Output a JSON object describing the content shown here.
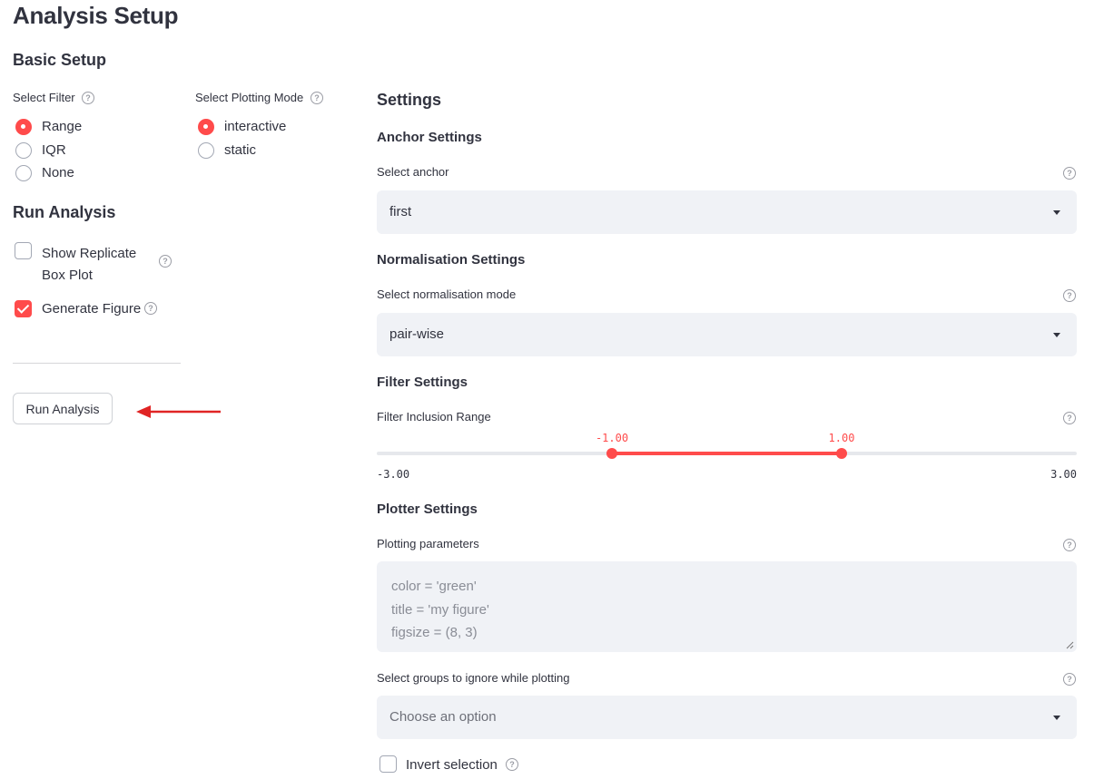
{
  "page_title": "Analysis Setup",
  "basic_setup": {
    "heading": "Basic Setup",
    "filter": {
      "label": "Select Filter",
      "options": [
        "Range",
        "IQR",
        "None"
      ],
      "selected": "Range"
    },
    "plotting_mode": {
      "label": "Select Plotting Mode",
      "options": [
        "interactive",
        "static"
      ],
      "selected": "interactive"
    }
  },
  "run_analysis": {
    "heading": "Run Analysis",
    "show_replicate_box_plot": {
      "label_line1": "Show Replicate",
      "label_line2": "Box Plot",
      "checked": false
    },
    "generate_figure": {
      "label": "Generate Figure",
      "checked": true
    },
    "button_label": "Run Analysis"
  },
  "settings": {
    "heading": "Settings",
    "anchor": {
      "heading": "Anchor Settings",
      "label": "Select anchor",
      "value": "first"
    },
    "normalisation": {
      "heading": "Normalisation Settings",
      "label": "Select normalisation mode",
      "value": "pair-wise"
    },
    "filter": {
      "heading": "Filter Settings",
      "label": "Filter Inclusion Range",
      "min": "-3.00",
      "max": "3.00",
      "low": "-1.00",
      "high": "1.00",
      "min_value": -3,
      "max_value": 3,
      "low_value": -1,
      "high_value": 1
    },
    "plotter": {
      "heading": "Plotter Settings",
      "params_label": "Plotting parameters",
      "params_placeholder_lines": [
        "color = 'green'",
        "title = 'my figure'",
        "figsize = (8, 3)"
      ],
      "ignore_groups_label": "Select groups to ignore while plotting",
      "ignore_groups_placeholder": "Choose an option",
      "invert_selection": {
        "label": "Invert selection",
        "checked": false
      }
    }
  },
  "colors": {
    "accent": "#ff4b4b",
    "text": "#31333f",
    "input_bg": "#f0f2f6",
    "arrow": "#e02424"
  },
  "icons": {
    "help": "question-circle-icon",
    "dropdown": "caret-down-icon",
    "annotation": "arrow-left-icon"
  }
}
